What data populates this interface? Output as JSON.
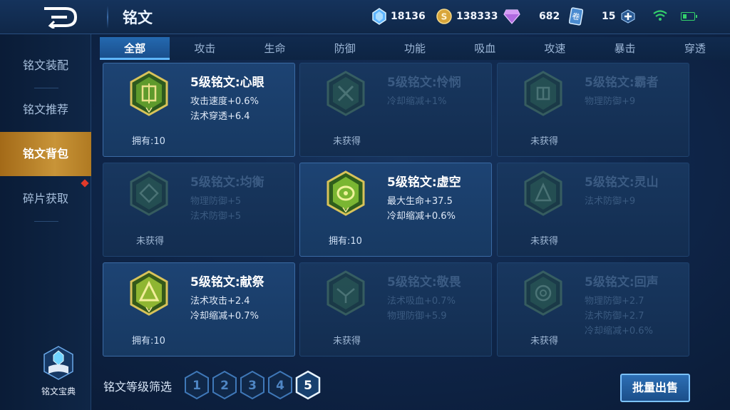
{
  "header": {
    "title": "铭文",
    "resources": [
      {
        "icon": "crystal-icon",
        "value": "18136"
      },
      {
        "icon": "coin-icon",
        "value": "138333"
      },
      {
        "icon": "diamond-icon",
        "value": "682"
      },
      {
        "icon": "voucher-card-icon",
        "value": "15"
      }
    ]
  },
  "tabs": [
    "全部",
    "攻击",
    "生命",
    "防御",
    "功能",
    "吸血",
    "攻速",
    "暴击",
    "穿透"
  ],
  "sidebar": {
    "items": [
      "铭文装配",
      "铭文推荐",
      "铭文背包",
      "碎片获取"
    ],
    "codex_label": "铭文宝典"
  },
  "cards": [
    {
      "name": "5级铭文:心眼",
      "stats": [
        "攻击速度+0.6%",
        "法术穿透+6.4"
      ],
      "status": "拥有:10",
      "owned": true,
      "color": "#c9b43a"
    },
    {
      "name": "5级铭文:怜悯",
      "stats": [
        "冷却缩减+1%"
      ],
      "status": "未获得",
      "owned": false,
      "color": "#4f8f55"
    },
    {
      "name": "5级铭文:霸者",
      "stats": [
        "物理防御+9"
      ],
      "status": "未获得",
      "owned": false,
      "color": "#4f8f55"
    },
    {
      "name": "5级铭文:均衡",
      "stats": [
        "物理防御+5",
        "法术防御+5"
      ],
      "status": "未获得",
      "owned": false,
      "color": "#4f8f55"
    },
    {
      "name": "5级铭文:虚空",
      "stats": [
        "最大生命+37.5",
        "冷却缩减+0.6%"
      ],
      "status": "拥有:10",
      "owned": true,
      "color": "#7cc23a"
    },
    {
      "name": "5级铭文:灵山",
      "stats": [
        "法术防御+9"
      ],
      "status": "未获得",
      "owned": false,
      "color": "#4f8f55"
    },
    {
      "name": "5级铭文:献祭",
      "stats": [
        "法术攻击+2.4",
        "冷却缩减+0.7%"
      ],
      "status": "拥有:10",
      "owned": true,
      "color": "#a8c23a"
    },
    {
      "name": "5级铭文:敬畏",
      "stats": [
        "法术吸血+0.7%",
        "物理防御+5.9"
      ],
      "status": "未获得",
      "owned": false,
      "color": "#4f8f55"
    },
    {
      "name": "5级铭文:回声",
      "stats": [
        "物理防御+2.7",
        "法术防御+2.7",
        "冷却缩减+0.6%"
      ],
      "status": "未获得",
      "owned": false,
      "color": "#4f8f55"
    }
  ],
  "filter": {
    "label": "铭文等级筛选",
    "levels": [
      "1",
      "2",
      "3",
      "4",
      "5"
    ],
    "selected": "5"
  },
  "sell_button": "批量出售",
  "colors": {
    "accent_gold": "#c89438",
    "tab_active": "#2469b0",
    "level_active": "#ffffff"
  }
}
